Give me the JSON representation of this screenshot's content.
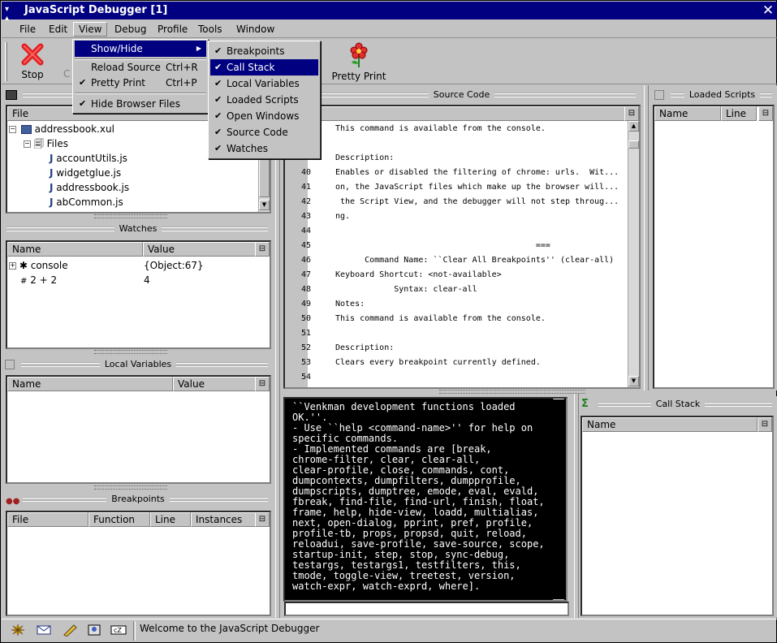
{
  "window": {
    "title": "JavaScript Debugger  [1]"
  },
  "menubar": {
    "file": "File",
    "edit": "Edit",
    "view": "View",
    "debug": "Debug",
    "profile": "Profile",
    "tools": "Tools",
    "window": "Window"
  },
  "toolbar": {
    "stop_label": "Stop",
    "partial_label": "C",
    "pretty_print_label": "Pretty Print"
  },
  "view_menu": {
    "show_hide": "Show/Hide",
    "reload_source": "Reload Source",
    "reload_source_accel": "Ctrl+R",
    "pretty_print": "Pretty Print",
    "pretty_print_accel": "Ctrl+P",
    "hide_browser_files": "Hide Browser Files"
  },
  "showhide_menu": {
    "items": [
      "Breakpoints",
      "Call Stack",
      "Local Variables",
      "Loaded Scripts",
      "Open Windows",
      "Source Code",
      "Watches"
    ]
  },
  "files_panel": {
    "column": "File",
    "root": "addressbook.xul",
    "folder": "Files",
    "files": [
      "accountUtils.js",
      "widgetglue.js",
      "addressbook.js",
      "abCommon.js"
    ]
  },
  "watches_panel": {
    "title": "Watches",
    "col_name": "Name",
    "col_value": "Value",
    "rows": [
      {
        "name": "console",
        "value": "{Object:67}"
      },
      {
        "name": "2 + 2",
        "value": "4"
      }
    ]
  },
  "locals_panel": {
    "title": "Local Variables",
    "col_name": "Name",
    "col_value": "Value"
  },
  "breakpoints_panel": {
    "title": "Breakpoints",
    "col_file": "File",
    "col_function": "Function",
    "col_line": "Line",
    "col_instances": "Instances"
  },
  "source_panel": {
    "title": "Source Code",
    "lines": [
      {
        "n": "",
        "t": "This command is available from the console."
      },
      {
        "n": "",
        "t": ""
      },
      {
        "n": "",
        "t": "Description:"
      },
      {
        "n": "40",
        "t": "Enables or disabled the filtering of chrome: urls.  Wit..."
      },
      {
        "n": "41",
        "t": "on, the JavaScript files which make up the browser will..."
      },
      {
        "n": "42",
        "t": " the Script View, and the debugger will not step throug..."
      },
      {
        "n": "43",
        "t": "ng."
      },
      {
        "n": "44",
        "t": ""
      },
      {
        "n": "45",
        "t": "                                         ==="
      },
      {
        "n": "46",
        "t": "      Command Name: ``Clear All Breakpoints'' (clear-all)"
      },
      {
        "n": "47",
        "t": "Keyboard Shortcut: <not-available>"
      },
      {
        "n": "48",
        "t": "            Syntax: clear-all"
      },
      {
        "n": "49",
        "t": "Notes:"
      },
      {
        "n": "50",
        "t": "This command is available from the console."
      },
      {
        "n": "51",
        "t": ""
      },
      {
        "n": "52",
        "t": "Description:"
      },
      {
        "n": "53",
        "t": "Clears every breakpoint currently defined."
      },
      {
        "n": "54",
        "t": ""
      }
    ]
  },
  "scripts_panel": {
    "title": "Loaded Scripts",
    "col_name": "Name",
    "col_line": "Line"
  },
  "console": {
    "lines": [
      "``Venkman development functions loaded",
      "OK.''.",
      "- Use ``help <command-name>'' for help on",
      "specific commands.",
      "- Implemented commands are [break,",
      "chrome-filter, clear, clear-all,",
      "clear-profile, close, commands, cont,",
      "dumpcontexts, dumpfilters, dumpprofile,",
      "dumpscripts, dumptree, emode, eval, evald,",
      "fbreak, find-file, find-url, finish, float,",
      "frame, help, hide-view, loadd, multialias,",
      "next, open-dialog, pprint, pref, profile,",
      "profile-tb, props, propsd, quit, reload,",
      "reloadui, save-profile, save-source, scope,",
      "startup-init, step, stop, sync-debug,",
      "testargs, testargs1, testfilters, this,",
      "tmode, toggle-view, treetest, version,",
      "watch-expr, watch-exprd, where]."
    ],
    "input_value": ""
  },
  "callstack_panel": {
    "title": "Call Stack",
    "col_name": "Name"
  },
  "statusbar": {
    "message": "Welcome to the JavaScript Debugger"
  },
  "colors": {
    "titlebar": "#000080",
    "selection": "#000080",
    "stop_red": "#e02020"
  }
}
